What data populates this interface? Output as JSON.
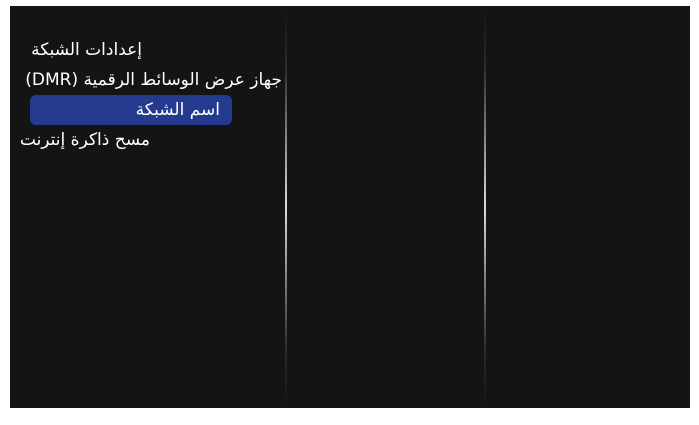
{
  "menu": {
    "items": [
      {
        "label": "إعدادات الشبكة",
        "selected": false
      },
      {
        "label": "جهاز عرض الوسائط الرقمية (DMR)",
        "selected": false
      },
      {
        "label": "اسم الشبكة",
        "selected": true
      },
      {
        "label": "مسح ذاكرة إنترنت",
        "selected": false
      }
    ]
  },
  "colors": {
    "background": "#141414",
    "highlight": "#233a8e",
    "text": "#ffffff"
  }
}
